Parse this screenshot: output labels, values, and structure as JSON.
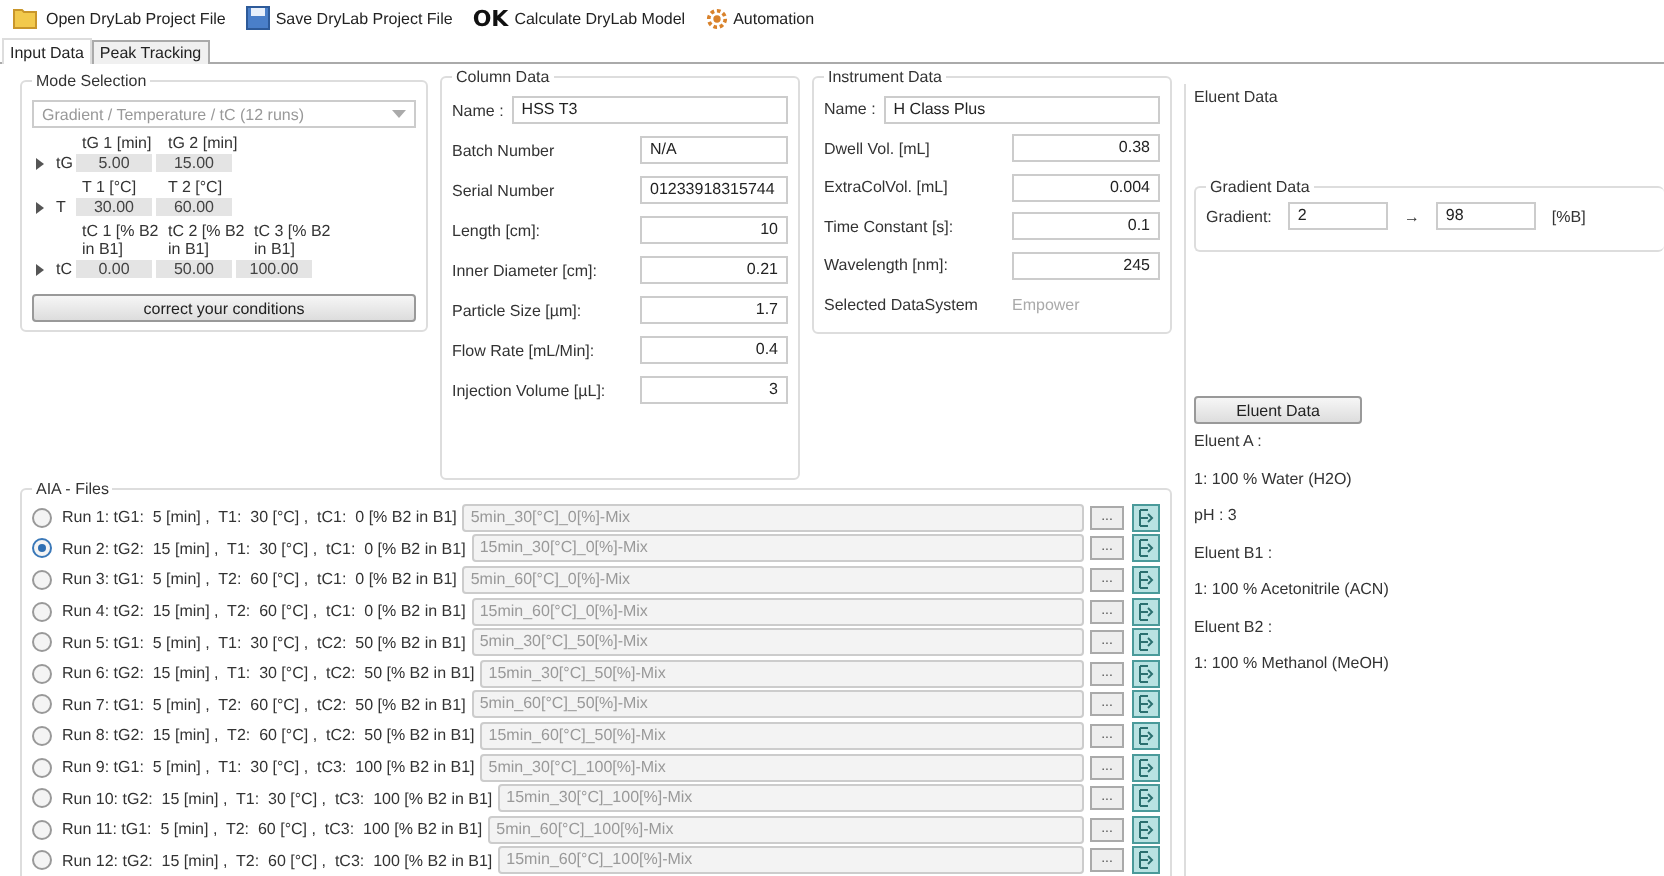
{
  "toolbar": [
    {
      "kind": "open",
      "label": "Open DryLab Project File"
    },
    {
      "kind": "save",
      "label": "Save DryLab Project File"
    },
    {
      "kind": "ok",
      "glyph": "OK",
      "label": "Calculate DryLab Model"
    },
    {
      "kind": "gear",
      "label": "Automation"
    }
  ],
  "tabs": [
    {
      "label": "Input Data",
      "selected": true
    },
    {
      "label": "Peak Tracking",
      "selected": false
    }
  ],
  "mode_selection": {
    "title": "Mode Selection",
    "dropdown": "Gradient / Temperature / tC (12 runs)",
    "parameters": [
      {
        "name": "tG",
        "headers": [
          "tG 1 [min]",
          "tG 2 [min]"
        ],
        "values": [
          "5.00",
          "15.00"
        ]
      },
      {
        "name": "T",
        "headers": [
          "T 1 [°C]",
          "T 2 [°C]"
        ],
        "values": [
          "30.00",
          "60.00"
        ]
      },
      {
        "name": "tC",
        "headers": [
          "tC 1 [% B2 in B1]",
          "tC 2 [% B2 in B1]",
          "tC 3 [% B2 in B1]"
        ],
        "values": [
          "0.00",
          "50.00",
          "100.00"
        ]
      }
    ],
    "button": "correct your conditions"
  },
  "column_data": {
    "title": "Column Data",
    "fields": [
      {
        "kind": "name",
        "label": "Name :",
        "value": "HSS T3"
      },
      {
        "kind": "text",
        "label": "Batch Number",
        "value": "N/A"
      },
      {
        "kind": "text",
        "label": "Serial Number",
        "value": "01233918315744"
      },
      {
        "kind": "number",
        "label": "Length [cm]:",
        "value": "10"
      },
      {
        "kind": "number",
        "label": "Inner Diameter [cm]:",
        "value": "0.21"
      },
      {
        "kind": "number",
        "label": "Particle Size [µm]:",
        "value": "1.7"
      },
      {
        "kind": "number",
        "label": "Flow Rate [mL/Min]:",
        "value": "0.4"
      },
      {
        "kind": "number",
        "label": "Injection Volume [µL]:",
        "value": "3"
      }
    ]
  },
  "instrument_data": {
    "title": "Instrument Data",
    "fields": [
      {
        "kind": "name",
        "label": "Name :",
        "value": "H Class Plus"
      },
      {
        "kind": "number",
        "label": "Dwell Vol. [mL]",
        "value": "0.38"
      },
      {
        "kind": "number",
        "label": "ExtraColVol. [mL]",
        "value": "0.004"
      },
      {
        "kind": "number",
        "label": "Time Constant [s]:",
        "value": "0.1"
      },
      {
        "kind": "number",
        "label": "Wavelength [nm]:",
        "value": "245"
      },
      {
        "kind": "readonly",
        "label": "Selected DataSystem",
        "value": "Empower"
      }
    ]
  },
  "eluent_data": {
    "title": "Eluent Data",
    "gradient_data": {
      "title": "Gradient Data",
      "label": "Gradient:",
      "from": "2",
      "arrow": "→",
      "to": "98",
      "unit": "[%B]"
    },
    "button": "Eluent Data",
    "lines": [
      "Eluent A :",
      "1: 100 % Water (H2O)",
      "pH : 3",
      "Eluent B1 :",
      "1: 100 % Acetonitrile (ACN)",
      "Eluent B2 :",
      "1: 100 % Methanol (MeOH)"
    ]
  },
  "aia_files": {
    "title": "AIA - Files",
    "browse": "...",
    "runs": [
      {
        "label": "Run 1: tG1:  5 [min] ,  T1:  30 [°C] ,  tC1:  0 [% B2 in B1]",
        "file": "5min_30[°C]_0[%]-Mix",
        "selected": false
      },
      {
        "label": "Run 2: tG2:  15 [min] ,  T1:  30 [°C] ,  tC1:  0 [% B2 in B1]",
        "file": "15min_30[°C]_0[%]-Mix",
        "selected": true
      },
      {
        "label": "Run 3: tG1:  5 [min] ,  T2:  60 [°C] ,  tC1:  0 [% B2 in B1]",
        "file": "5min_60[°C]_0[%]-Mix",
        "selected": false
      },
      {
        "label": "Run 4: tG2:  15 [min] ,  T2:  60 [°C] ,  tC1:  0 [% B2 in B1]",
        "file": "15min_60[°C]_0[%]-Mix",
        "selected": false
      },
      {
        "label": "Run 5: tG1:  5 [min] ,  T1:  30 [°C] ,  tC2:  50 [% B2 in B1]",
        "file": "5min_30[°C]_50[%]-Mix",
        "selected": false
      },
      {
        "label": "Run 6: tG2:  15 [min] ,  T1:  30 [°C] ,  tC2:  50 [% B2 in B1]",
        "file": "15min_30[°C]_50[%]-Mix",
        "selected": false
      },
      {
        "label": "Run 7: tG1:  5 [min] ,  T2:  60 [°C] ,  tC2:  50 [% B2 in B1]",
        "file": "5min_60[°C]_50[%]-Mix",
        "selected": false
      },
      {
        "label": "Run 8: tG2:  15 [min] ,  T2:  60 [°C] ,  tC2:  50 [% B2 in B1]",
        "file": "15min_60[°C]_50[%]-Mix",
        "selected": false
      },
      {
        "label": "Run 9: tG1:  5 [min] ,  T1:  30 [°C] ,  tC3:  100 [% B2 in B1]",
        "file": "5min_30[°C]_100[%]-Mix",
        "selected": false
      },
      {
        "label": "Run 10: tG2:  15 [min] ,  T1:  30 [°C] ,  tC3:  100 [% B2 in B1]",
        "file": "15min_30[°C]_100[%]-Mix",
        "selected": false
      },
      {
        "label": "Run 11: tG1:  5 [min] ,  T2:  60 [°C] ,  tC3:  100 [% B2 in B1]",
        "file": "5min_60[°C]_100[%]-Mix",
        "selected": false
      },
      {
        "label": "Run 12: tG2:  15 [min] ,  T2:  60 [°C] ,  tC3:  100 [% B2 in B1]",
        "file": "15min_60[°C]_100[%]-Mix",
        "selected": false
      }
    ]
  }
}
